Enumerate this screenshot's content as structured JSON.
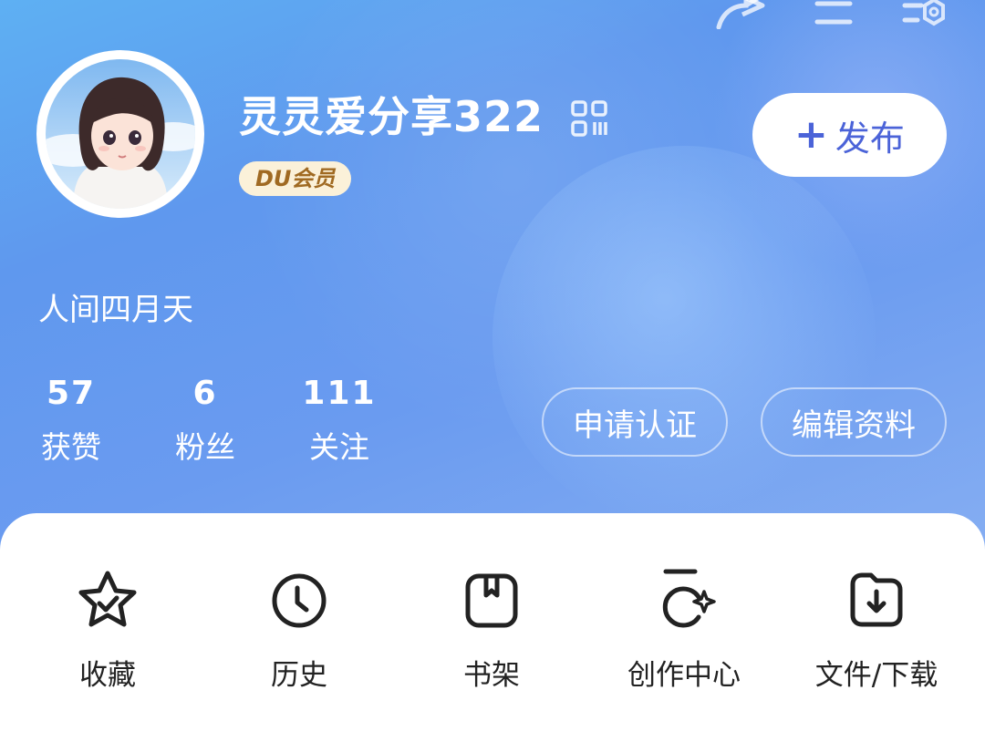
{
  "profile": {
    "username": "灵灵爱分享322",
    "badge": "DU会员",
    "bio": "人间四月天"
  },
  "actions": {
    "publish_label": "发布",
    "verify_label": "申请认证",
    "edit_label": "编辑资料"
  },
  "stats": [
    {
      "value": "57",
      "label": "获赞"
    },
    {
      "value": "6",
      "label": "粉丝"
    },
    {
      "value": "111",
      "label": "关注"
    }
  ],
  "menu": [
    {
      "label": "收藏",
      "icon": "star-check-icon"
    },
    {
      "label": "历史",
      "icon": "clock-icon"
    },
    {
      "label": "书架",
      "icon": "bookmark-box-icon"
    },
    {
      "label": "创作中心",
      "icon": "sparkle-icon"
    },
    {
      "label": "文件/下载",
      "icon": "folder-download-icon"
    }
  ],
  "colors": {
    "accent": "#4b63d8",
    "badge_bg": "#fbf1d9",
    "badge_text": "#a06a22"
  }
}
